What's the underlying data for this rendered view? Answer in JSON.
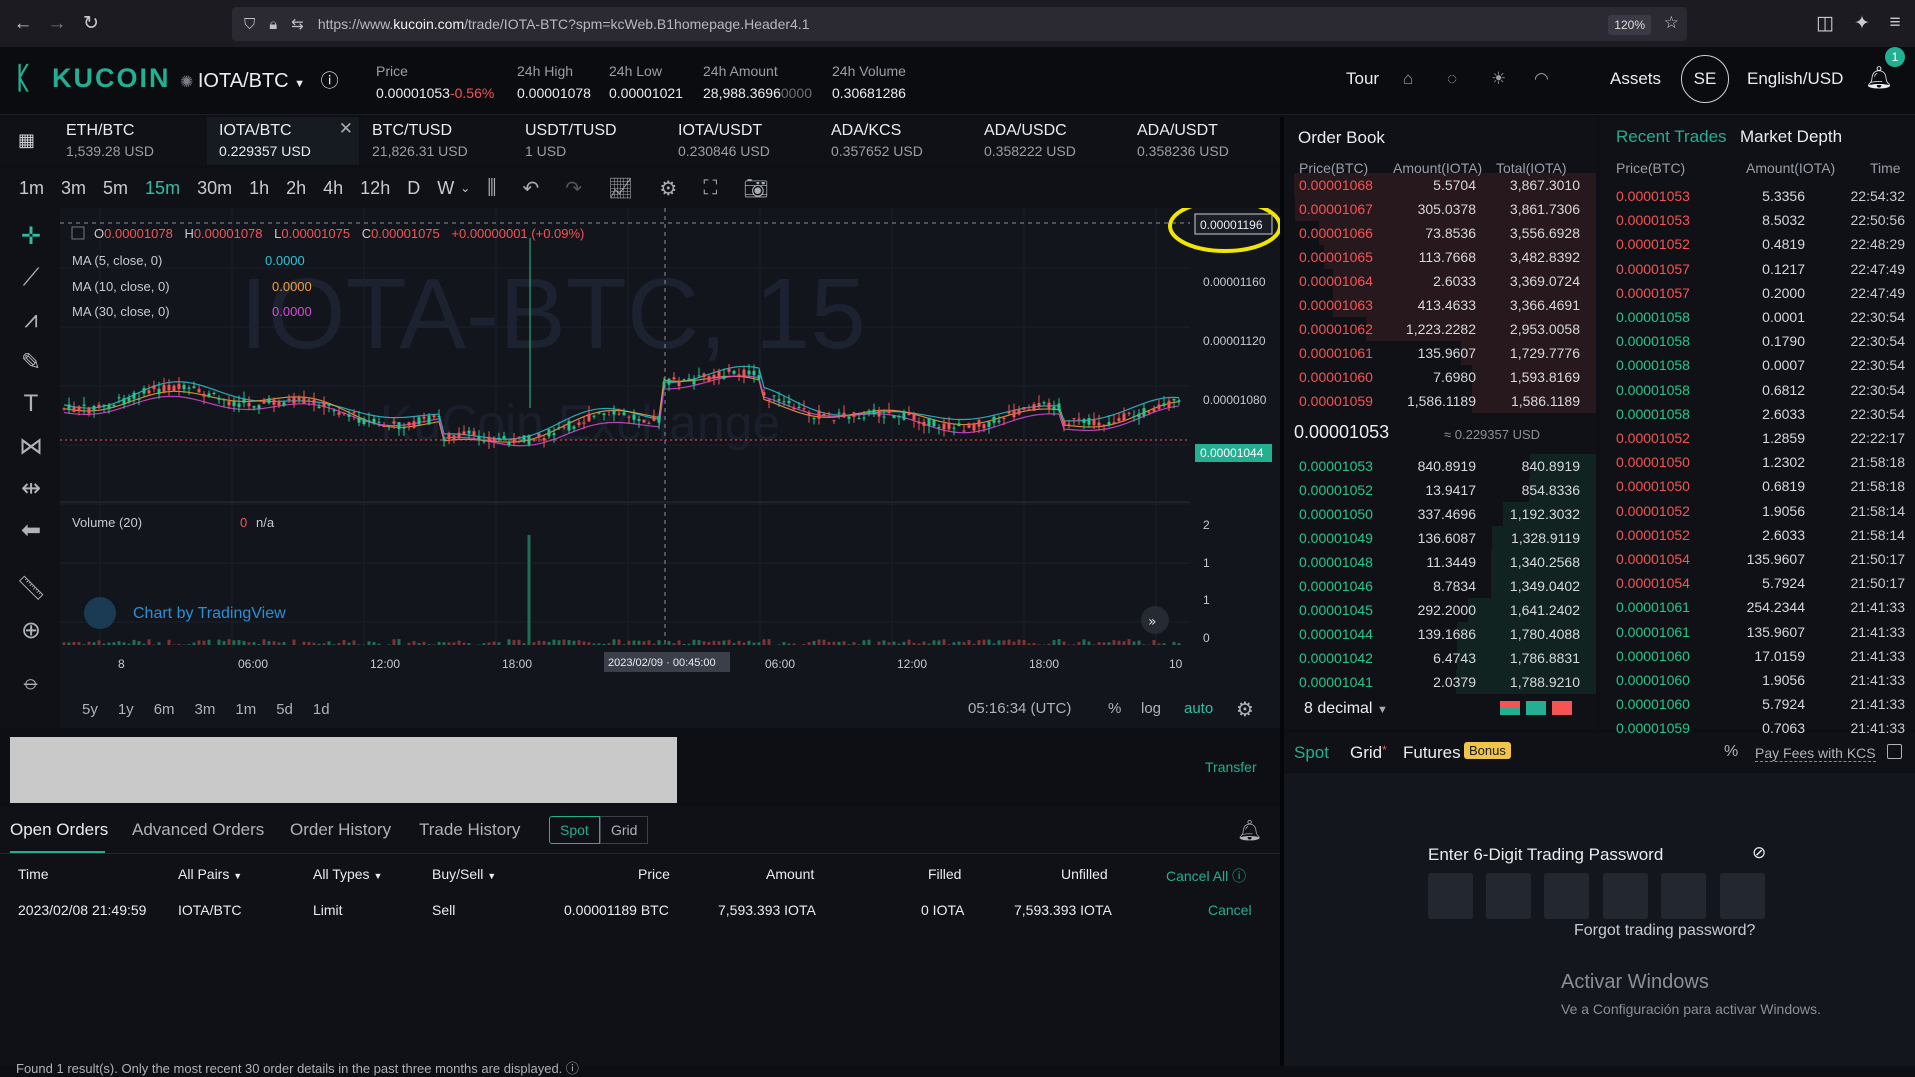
{
  "browser": {
    "url_prefix": "https://www.",
    "url_domain": "kucoin.com",
    "url_path": "/trade/IOTA-BTC?spm=kcWeb.B1homepage.Header4.1",
    "zoom": "120%"
  },
  "header": {
    "logo": "KUCOIN",
    "pair": "IOTA/BTC",
    "price_label": "Price",
    "price": "0.00001053",
    "price_change": "-0.56%",
    "high_label": "24h High",
    "high": "0.00001078",
    "low_label": "24h Low",
    "low": "0.00001021",
    "amount_label": "24h Amount",
    "amount_main": "28,988.3696",
    "amount_dim": "0000",
    "volume_label": "24h Volume",
    "volume": "0.30681286",
    "tour": "Tour",
    "assets": "Assets",
    "avatar": "SE",
    "language": "English/USD",
    "notif_count": "1"
  },
  "pair_tabs": [
    {
      "name": "ETH/BTC",
      "price": "1,539.28 USD"
    },
    {
      "name": "IOTA/BTC",
      "price": "0.229357 USD"
    },
    {
      "name": "BTC/TUSD",
      "price": "21,826.31 USD"
    },
    {
      "name": "USDT/TUSD",
      "price": "1 USD"
    },
    {
      "name": "IOTA/USDT",
      "price": "0.230846 USD"
    },
    {
      "name": "ADA/KCS",
      "price": "0.357652 USD"
    },
    {
      "name": "ADA/USDC",
      "price": "0.358222 USD"
    },
    {
      "name": "ADA/USDT",
      "price": "0.358236 USD"
    }
  ],
  "intervals": [
    "1m",
    "3m",
    "5m",
    "15m",
    "30m",
    "1h",
    "2h",
    "4h",
    "12h",
    "D",
    "W"
  ],
  "chart": {
    "ohlc": {
      "o_label": "O",
      "o": "0.00001078",
      "h_label": "H",
      "h": "0.00001078",
      "l_label": "L",
      "l": "0.00001075",
      "c_label": "C",
      "c": "0.00001075",
      "change": "+0.00000001 (+0.09%)"
    },
    "ma": [
      {
        "label": "MA (5, close, 0)",
        "value": "0.0000",
        "color": "#2bc4d8"
      },
      {
        "label": "MA (10, close, 0)",
        "value": "0.0000",
        "color": "#f0a23b"
      },
      {
        "label": "MA (30, close, 0)",
        "value": "0.0000",
        "color": "#d94ad9"
      }
    ],
    "watermark_main": "IOTA-BTC, 15",
    "watermark_sub": "KuCoin Exchange",
    "y_ticks": [
      "0.00001160",
      "0.00001120",
      "0.00001080"
    ],
    "crosshair_price": "0.00001196",
    "last_price": "0.00001044",
    "volume_label": "Volume (20)",
    "volume_value": "0",
    "volume_na": "n/a",
    "vol_ticks": [
      "2",
      "1",
      "1",
      "0"
    ],
    "x_ticks": [
      "8",
      "06:00",
      "12:00",
      "18:00",
      "06:00",
      "12:00",
      "18:00",
      "10"
    ],
    "crosshair_time": "2023/02/09 · 00:45:00",
    "tradingview": "Chart by TradingView",
    "ranges": [
      "5y",
      "1y",
      "6m",
      "3m",
      "1m",
      "5d",
      "1d"
    ],
    "clock": "05:16:34 (UTC)",
    "pct": "%",
    "log": "log",
    "auto": "auto"
  },
  "order_book": {
    "title": "Order Book",
    "headers": [
      "Price(BTC)",
      "Amount(IOTA)",
      "Total(IOTA)"
    ],
    "asks": [
      [
        "0.00001068",
        "5.5704",
        "3,867.3010"
      ],
      [
        "0.00001067",
        "305.0378",
        "3,861.7306"
      ],
      [
        "0.00001066",
        "73.8536",
        "3,556.6928"
      ],
      [
        "0.00001065",
        "113.7668",
        "3,482.8392"
      ],
      [
        "0.00001064",
        "2.6033",
        "3,369.0724"
      ],
      [
        "0.00001063",
        "413.4633",
        "3,366.4691"
      ],
      [
        "0.00001062",
        "1,223.2282",
        "2,953.0058"
      ],
      [
        "0.00001061",
        "135.9607",
        "1,729.7776"
      ],
      [
        "0.00001060",
        "7.6980",
        "1,593.8169"
      ],
      [
        "0.00001059",
        "1,586.1189",
        "1,586.1189"
      ]
    ],
    "mid_price": "0.00001053",
    "mid_usd": "≈ 0.229357 USD",
    "bids": [
      [
        "0.00001053",
        "840.8919",
        "840.8919"
      ],
      [
        "0.00001052",
        "13.9417",
        "854.8336"
      ],
      [
        "0.00001050",
        "337.4696",
        "1,192.3032"
      ],
      [
        "0.00001049",
        "136.6087",
        "1,328.9119"
      ],
      [
        "0.00001048",
        "11.3449",
        "1,340.2568"
      ],
      [
        "0.00001046",
        "8.7834",
        "1,349.0402"
      ],
      [
        "0.00001045",
        "292.2000",
        "1,641.2402"
      ],
      [
        "0.00001044",
        "139.1686",
        "1,780.4088"
      ],
      [
        "0.00001042",
        "6.4743",
        "1,786.8831"
      ],
      [
        "0.00001041",
        "2.0379",
        "1,788.9210"
      ]
    ],
    "decimal": "8 decimal"
  },
  "recent_trades": {
    "tab1": "Recent Trades",
    "tab2": "Market Depth",
    "headers": [
      "Price(BTC)",
      "Amount(IOTA)",
      "Time"
    ],
    "rows": [
      [
        "0.00001053",
        "5.3356",
        "22:54:32",
        "sell"
      ],
      [
        "0.00001053",
        "8.5032",
        "22:50:56",
        "sell"
      ],
      [
        "0.00001052",
        "0.4819",
        "22:48:29",
        "sell"
      ],
      [
        "0.00001057",
        "0.1217",
        "22:47:49",
        "sell"
      ],
      [
        "0.00001057",
        "0.2000",
        "22:47:49",
        "sell"
      ],
      [
        "0.00001058",
        "0.0001",
        "22:30:54",
        "buy"
      ],
      [
        "0.00001058",
        "0.1790",
        "22:30:54",
        "buy"
      ],
      [
        "0.00001058",
        "0.0007",
        "22:30:54",
        "buy"
      ],
      [
        "0.00001058",
        "0.6812",
        "22:30:54",
        "buy"
      ],
      [
        "0.00001058",
        "2.6033",
        "22:30:54",
        "buy"
      ],
      [
        "0.00001052",
        "1.2859",
        "22:22:17",
        "sell"
      ],
      [
        "0.00001050",
        "1.2302",
        "21:58:18",
        "sell"
      ],
      [
        "0.00001050",
        "0.6819",
        "21:58:18",
        "sell"
      ],
      [
        "0.00001052",
        "1.9056",
        "21:58:14",
        "sell"
      ],
      [
        "0.00001052",
        "2.6033",
        "21:58:14",
        "sell"
      ],
      [
        "0.00001054",
        "135.9607",
        "21:50:17",
        "sell"
      ],
      [
        "0.00001054",
        "5.7924",
        "21:50:17",
        "sell"
      ],
      [
        "0.00001061",
        "254.2344",
        "21:41:33",
        "buy"
      ],
      [
        "0.00001061",
        "135.9607",
        "21:41:33",
        "buy"
      ],
      [
        "0.00001060",
        "17.0159",
        "21:41:33",
        "buy"
      ],
      [
        "0.00001060",
        "1.9056",
        "21:41:33",
        "buy"
      ],
      [
        "0.00001060",
        "5.7924",
        "21:41:33",
        "buy"
      ],
      [
        "0.00001059",
        "0.7063",
        "21:41:33",
        "buy"
      ]
    ]
  },
  "orders": {
    "transfer": "Transfer",
    "tabs": [
      "Open Orders",
      "Advanced Orders",
      "Order History",
      "Trade History"
    ],
    "seg_spot": "Spot",
    "seg_grid": "Grid",
    "headers": {
      "time": "Time",
      "pairs": "All Pairs",
      "types": "All Types",
      "side": "Buy/Sell",
      "price": "Price",
      "amount": "Amount",
      "filled": "Filled",
      "unfilled": "Unfilled",
      "cancel_all": "Cancel All"
    },
    "row": {
      "time": "2023/02/08 21:49:59",
      "pair": "IOTA/BTC",
      "type": "Limit",
      "side": "Sell",
      "price": "0.00001189 BTC",
      "amount": "7,593.393 IOTA",
      "filled": "0 IOTA",
      "unfilled": "7,593.393 IOTA",
      "cancel": "Cancel"
    },
    "footer": "Found 1 result(s). Only the most recent 30 order details in the past three months are displayed."
  },
  "trade_panel": {
    "tab_spot": "Spot",
    "tab_grid": "Grid",
    "tab_futures": "Futures",
    "bonus": "Bonus",
    "fees": "Pay Fees with KCS",
    "pwd_label": "Enter 6-Digit Trading Password",
    "forgot": "Forgot trading password?",
    "win1": "Activar Windows",
    "win2": "Ve a Configuración para activar Windows."
  },
  "colors": {
    "accent": "#23af91",
    "up": "#23c78b",
    "down": "#f65454",
    "annotation": "#f2e600"
  }
}
